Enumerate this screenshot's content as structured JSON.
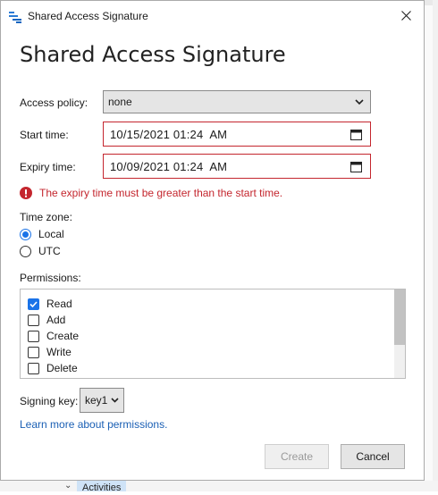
{
  "window": {
    "title": "Shared Access Signature"
  },
  "heading": "Shared Access Signature",
  "access_policy": {
    "label": "Access policy:",
    "value": "none"
  },
  "start_time": {
    "label": "Start time:",
    "value": "10/15/2021 01:24  AM"
  },
  "expiry_time": {
    "label": "Expiry time:",
    "value": "10/09/2021 01:24  AM"
  },
  "error": {
    "message": "The expiry time must be greater than the start time."
  },
  "time_zone": {
    "label": "Time zone:",
    "options": [
      {
        "label": "Local",
        "selected": true
      },
      {
        "label": "UTC",
        "selected": false
      }
    ]
  },
  "permissions": {
    "label": "Permissions:",
    "items": [
      {
        "label": "Read",
        "checked": true
      },
      {
        "label": "Add",
        "checked": false
      },
      {
        "label": "Create",
        "checked": false
      },
      {
        "label": "Write",
        "checked": false
      },
      {
        "label": "Delete",
        "checked": false
      }
    ]
  },
  "signing_key": {
    "label": "Signing key:",
    "value": "key1"
  },
  "link_text": "Learn more about permissions.",
  "buttons": {
    "create": "Create",
    "cancel": "Cancel"
  },
  "background": {
    "activities_label": "Activities"
  },
  "colors": {
    "error": "#c4262e",
    "accent": "#1a73e8",
    "link": "#1a5fb4"
  },
  "icons": {
    "app": "storage-explorer-icon",
    "close": "close-icon",
    "dropdown": "chevron-down-icon",
    "calendar": "calendar-icon",
    "error": "error-icon"
  }
}
